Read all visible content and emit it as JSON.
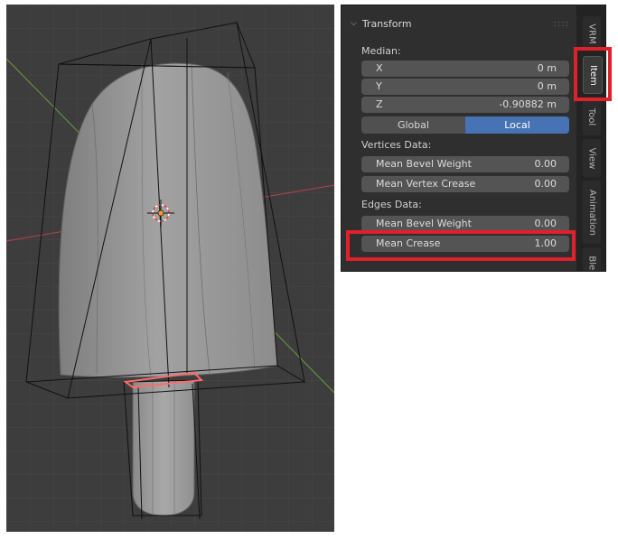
{
  "panel": {
    "header": "Transform",
    "chevron_icon": "chevron-down-icon",
    "grip_icon": "drag-grip-icon",
    "median_label": "Median:",
    "median": [
      {
        "label": "X",
        "value": "0 m"
      },
      {
        "label": "Y",
        "value": "0 m"
      },
      {
        "label": "Z",
        "value": "-0.90882 m"
      }
    ],
    "space_toggle": {
      "global": "Global",
      "local": "Local",
      "active": "Local"
    },
    "vertices_label": "Vertices Data:",
    "vertices": [
      {
        "label": "Mean Bevel Weight",
        "value": "0.00"
      },
      {
        "label": "Mean Vertex Crease",
        "value": "0.00"
      }
    ],
    "edges_label": "Edges Data:",
    "edges": [
      {
        "label": "Mean Bevel Weight",
        "value": "0.00"
      },
      {
        "label": "Mean Crease",
        "value": "1.00"
      }
    ]
  },
  "tabs": [
    {
      "label": "VRM"
    },
    {
      "label": "Item",
      "active": true
    },
    {
      "label": "Tool"
    },
    {
      "label": "View"
    },
    {
      "label": "Animation"
    },
    {
      "label": "Blen"
    }
  ],
  "colors": {
    "highlight": "#e0202a",
    "active_toggle": "#4772b3",
    "selected_edge": "#ff6a6a",
    "x_axis": "#b8404c",
    "y_axis": "#6e9a3a"
  }
}
